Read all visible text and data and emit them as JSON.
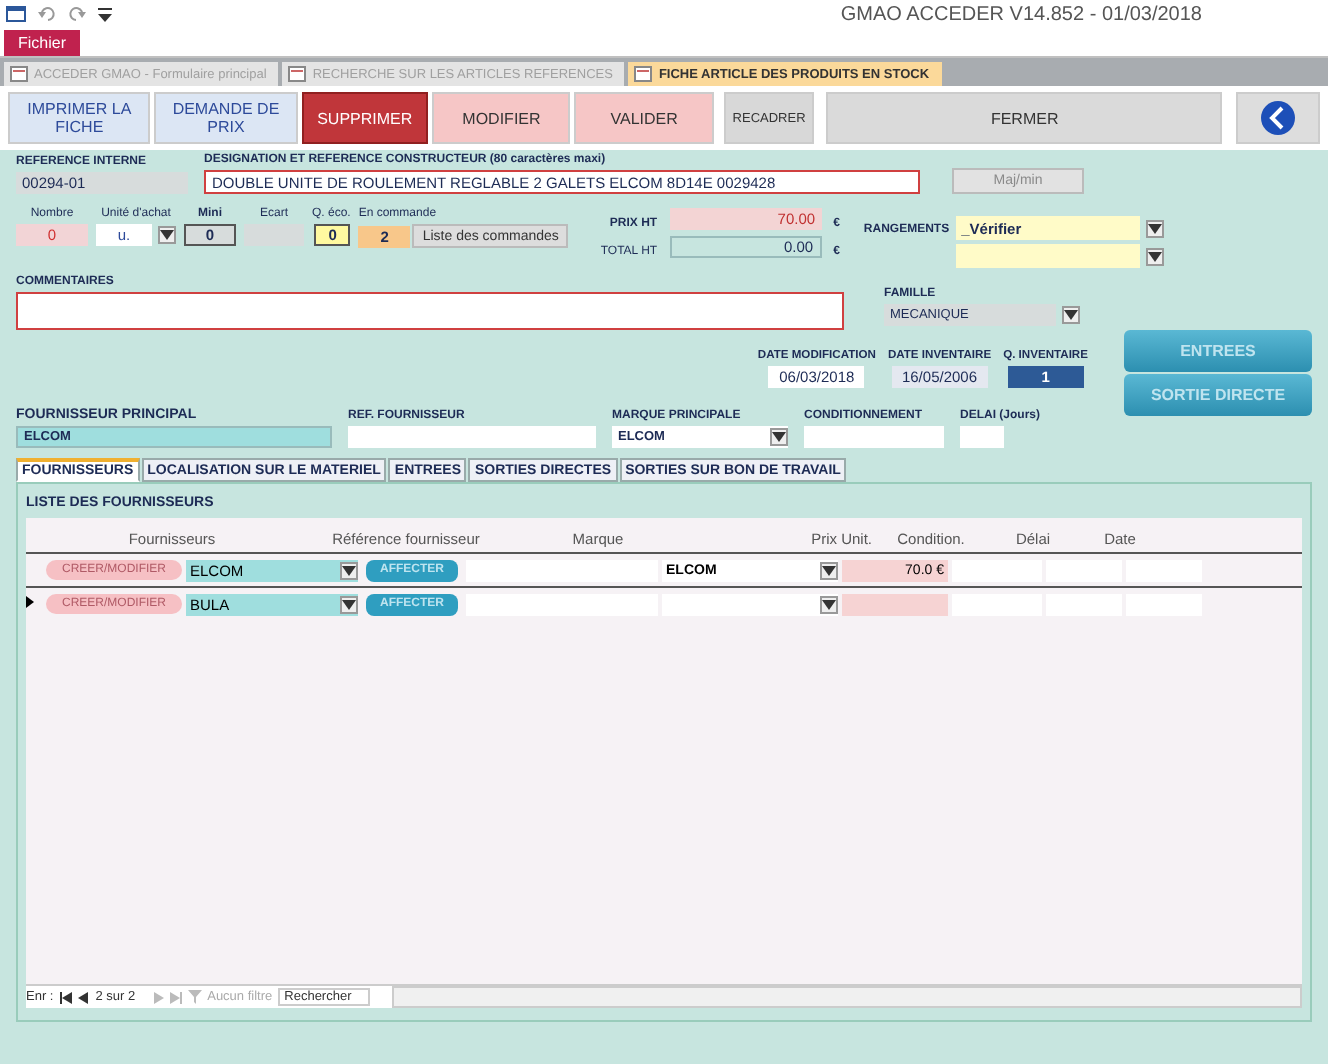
{
  "window": {
    "title": "GMAO ACCEDER V14.852 - 01/03/2018"
  },
  "ribbon_tab": {
    "label": "Fichier"
  },
  "doc_tabs": [
    {
      "label": "ACCEDER GMAO - Formulaire principal",
      "selected": false
    },
    {
      "label": "RECHERCHE SUR LES ARTICLES REFERENCES",
      "selected": false
    },
    {
      "label": "FICHE ARTICLE DES PRODUITS EN STOCK",
      "selected": true
    }
  ],
  "toolbar": [
    {
      "label": "IMPRIMER LA FICHE",
      "kind": "light"
    },
    {
      "label": "DEMANDE DE PRIX",
      "kind": "light"
    },
    {
      "label": "SUPPRIMER",
      "kind": "danger"
    },
    {
      "label": "MODIFIER",
      "kind": "pink"
    },
    {
      "label": "VALIDER",
      "kind": "pink"
    },
    {
      "label": "RECADRER",
      "kind": "grey"
    },
    {
      "label": "FERMER",
      "kind": "wide"
    },
    {
      "kind": "back"
    }
  ],
  "reference": {
    "label": "REFERENCE INTERNE",
    "value": "00294-01"
  },
  "designation": {
    "label": "DESIGNATION ET REFERENCE CONSTRUCTEUR (80 caractères maxi)",
    "value": "DOUBLE UNITE DE ROULEMENT REGLABLE 2 GALETS ELCOM  8D14E 0029428"
  },
  "majmin_button": {
    "label": "Maj/min",
    "disabled": true
  },
  "quantities": {
    "nombre": {
      "label": "Nombre",
      "value": "0"
    },
    "unite": {
      "label": "Unité d'achat",
      "value": "u."
    },
    "mini": {
      "label": "Mini",
      "value": "0"
    },
    "ecart": {
      "label": "Ecart"
    },
    "q_eco": {
      "label": "Q. éco.",
      "value": "0"
    },
    "en_commande": {
      "label": "En commande",
      "value": "2"
    },
    "orders_button": "Liste des commandes"
  },
  "prix_ht": {
    "label": "PRIX HT",
    "value": "70.00",
    "currency": "€"
  },
  "total_ht": {
    "label": "TOTAL HT",
    "value": "0.00",
    "currency": "€"
  },
  "rangements": {
    "label": "RANGEMENTS",
    "value": "_Vérifier"
  },
  "commentaires": {
    "label": "COMMENTAIRES"
  },
  "famille": {
    "label": "FAMILLE",
    "value": "MECANIQUE"
  },
  "dates": [
    {
      "label": "DATE MODIFICATION",
      "value": "06/03/2018",
      "kind": "plain"
    },
    {
      "label": "DATE INVENTAIRE",
      "value": "16/05/2006",
      "kind": "grey"
    },
    {
      "label": "Q. INVENTAIRE",
      "value": "1",
      "kind": "dark"
    }
  ],
  "action_buttons": [
    "ENTREES",
    "SORTIE DIRECTE"
  ],
  "fournisseur_principal": {
    "label": "FOURNISSEUR PRINCIPAL",
    "value": "ELCOM"
  },
  "ref_fournisseur": {
    "label": "REF. FOURNISSEUR"
  },
  "marque_principale": {
    "label": "MARQUE PRINCIPALE",
    "value": "ELCOM"
  },
  "conditionnement": {
    "label": "CONDITIONNEMENT"
  },
  "delai": {
    "label": "DELAI (Jours)"
  },
  "tabs": [
    {
      "label": "FOURNISSEURS",
      "selected": true
    },
    {
      "label": "LOCALISATION SUR LE MATERIEL",
      "selected": false
    },
    {
      "label": "ENTREES",
      "selected": false
    },
    {
      "label": "SORTIES DIRECTES",
      "selected": false
    },
    {
      "label": "SORTIES SUR BON DE TRAVAIL",
      "selected": false
    }
  ],
  "list": {
    "title": "LISTE DES FOURNISSEURS",
    "columns": [
      "Fournisseurs",
      "Référence fournisseur",
      "Marque",
      "Prix Unit.",
      "Condition.",
      "Délai",
      "Date"
    ],
    "rows": [
      {
        "current": false,
        "edit_button": "CREER/MODIFIER",
        "fournisseur": "ELCOM",
        "assign_button": "AFFECTER",
        "marque": "ELCOM",
        "prix": "70.0 €"
      },
      {
        "current": true,
        "edit_button": "CREER/MODIFIER",
        "fournisseur": "BULA",
        "assign_button": "AFFECTER"
      }
    ]
  },
  "navigator": {
    "label": "Enr :",
    "position": "2 sur 2",
    "filter": "Aucun filtre",
    "search": "Rechercher"
  }
}
